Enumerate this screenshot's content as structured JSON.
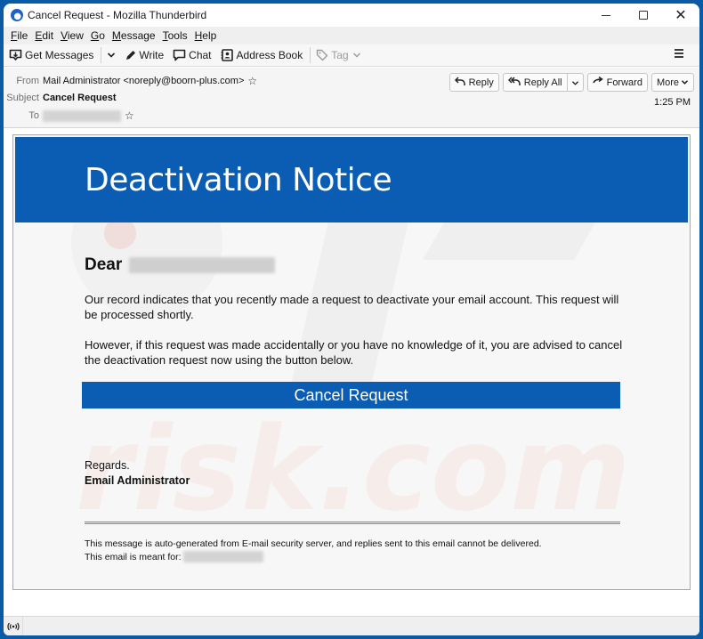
{
  "window": {
    "title": "Cancel Request - Mozilla Thunderbird",
    "controls": {
      "minimize": "minimize",
      "maximize": "maximize",
      "close": "✕"
    }
  },
  "menubar": {
    "items": [
      {
        "accel": "F",
        "rest": "ile"
      },
      {
        "accel": "E",
        "rest": "dit"
      },
      {
        "accel": "V",
        "rest": "iew"
      },
      {
        "accel": "G",
        "rest": "o"
      },
      {
        "accel": "M",
        "rest": "essage"
      },
      {
        "accel": "T",
        "rest": "ools"
      },
      {
        "accel": "H",
        "rest": "elp"
      }
    ]
  },
  "toolbar": {
    "get_messages": "Get Messages",
    "write": "Write",
    "chat": "Chat",
    "address_book": "Address Book",
    "tag": "Tag"
  },
  "header": {
    "from_label": "From",
    "from_value": "Mail Administrator <noreply@boorn-plus.com>",
    "subject_label": "Subject",
    "subject_value": "Cancel Request",
    "to_label": "To",
    "to_value": "",
    "time": "1:25 PM",
    "buttons": {
      "reply": "Reply",
      "reply_all": "Reply All",
      "forward": "Forward",
      "more": "More"
    }
  },
  "email": {
    "banner_title": "Deactivation Notice",
    "greeting": "Dear",
    "paragraph1": "Our record indicates that you recently made a request to deactivate your email account. This request will be processed shortly.",
    "paragraph2": "However, if this request was made accidentally or you have no knowledge of it, you are advised to cancel the deactivation request now using the button below.",
    "cta_label": "Cancel Request",
    "regards": "Regards.",
    "signature": "Email Administrator",
    "footer_line1": "This message is auto-generated from E-mail security server, and replies sent to this email cannot be delivered.",
    "footer_line2": "This email is meant for:",
    "accent_color": "#0b5cb3"
  },
  "statusbar": {
    "icon": "online-status-icon"
  }
}
